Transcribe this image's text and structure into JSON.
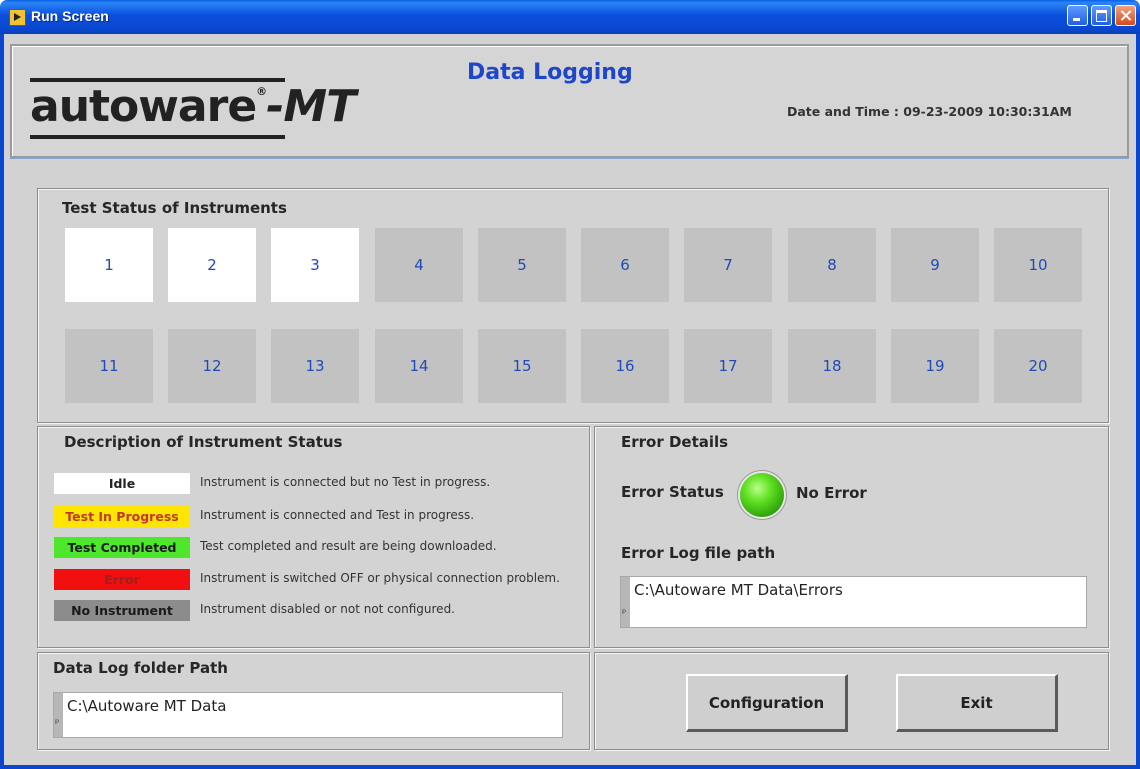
{
  "window": {
    "title": "Run Screen"
  },
  "header": {
    "logo_main": "autoware",
    "logo_reg": "®",
    "logo_suffix": "-MT",
    "title": "Data Logging",
    "datetime": "Date and Time : 09-23-2009 10:30:31AM"
  },
  "test_status": {
    "title": "Test Status of Instruments",
    "instruments": [
      {
        "label": "1",
        "status": "Idle"
      },
      {
        "label": "2",
        "status": "Idle"
      },
      {
        "label": "3",
        "status": "Idle"
      },
      {
        "label": "4",
        "status": "No Instrument"
      },
      {
        "label": "5",
        "status": "No Instrument"
      },
      {
        "label": "6",
        "status": "No Instrument"
      },
      {
        "label": "7",
        "status": "No Instrument"
      },
      {
        "label": "8",
        "status": "No Instrument"
      },
      {
        "label": "9",
        "status": "No Instrument"
      },
      {
        "label": "10",
        "status": "No Instrument"
      },
      {
        "label": "11",
        "status": "No Instrument"
      },
      {
        "label": "12",
        "status": "No Instrument"
      },
      {
        "label": "13",
        "status": "No Instrument"
      },
      {
        "label": "14",
        "status": "No Instrument"
      },
      {
        "label": "15",
        "status": "No Instrument"
      },
      {
        "label": "16",
        "status": "No Instrument"
      },
      {
        "label": "17",
        "status": "No Instrument"
      },
      {
        "label": "18",
        "status": "No Instrument"
      },
      {
        "label": "19",
        "status": "No Instrument"
      },
      {
        "label": "20",
        "status": "No Instrument"
      }
    ]
  },
  "description": {
    "title": "Description of Instrument Status",
    "items": [
      {
        "label": "Idle",
        "desc": "Instrument is connected but no Test in progress.",
        "bg": "#ffffff",
        "fg": "#222222"
      },
      {
        "label": "Test In Progress",
        "desc": "Instrument is connected and Test in progress.",
        "bg": "#ffe600",
        "fg": "#c0392b"
      },
      {
        "label": "Test Completed",
        "desc": "Test completed and result are being downloaded.",
        "bg": "#4de82c",
        "fg": "#1a1a1a"
      },
      {
        "label": "Error",
        "desc": "Instrument is switched OFF or physical connection problem.",
        "bg": "#f20f0f",
        "fg": "#a02020"
      },
      {
        "label": "No Instrument",
        "desc": "Instrument disabled or not not configured.",
        "bg": "#8c8c8c",
        "fg": "#1a1a1a"
      }
    ]
  },
  "error": {
    "title": "Error Details",
    "status_label": "Error Status",
    "status_value": "No Error",
    "led_color": "#35c51a",
    "log_label": "Error Log file path",
    "log_path": "C:\\Autoware MT Data\\Errors"
  },
  "data_log": {
    "title": "Data Log folder Path",
    "path": "C:\\Autoware MT Data"
  },
  "buttons": {
    "configuration": "Configuration",
    "exit": "Exit"
  }
}
